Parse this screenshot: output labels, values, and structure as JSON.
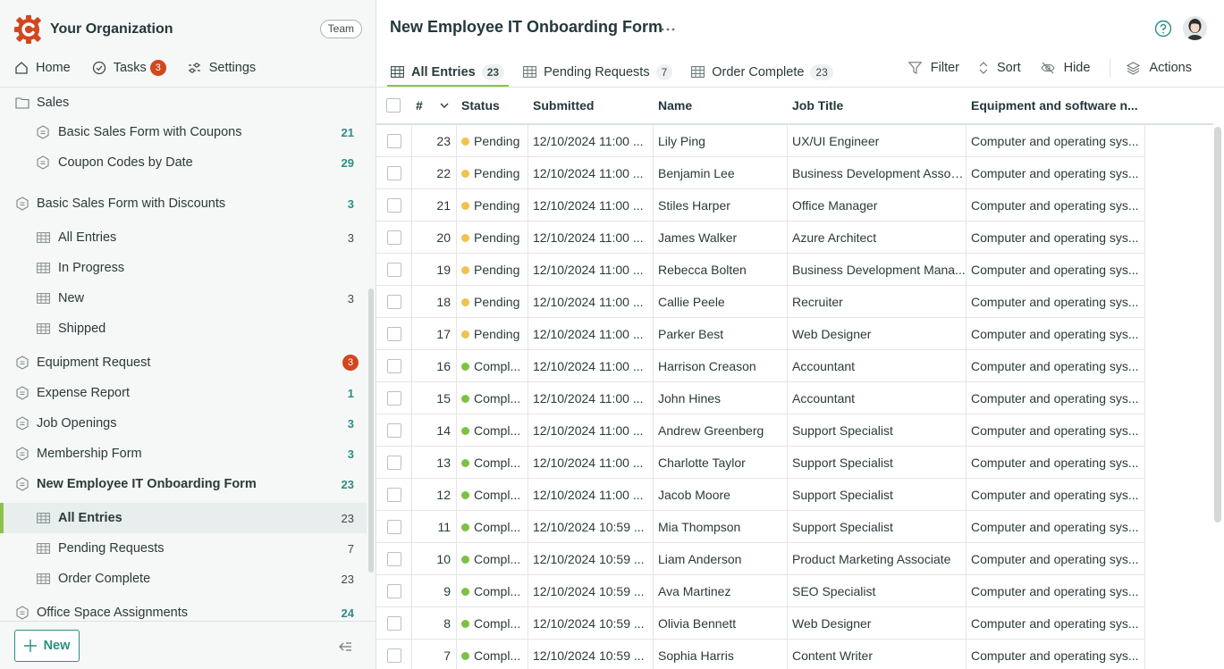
{
  "org": {
    "name": "Your Organization",
    "chip": "Team"
  },
  "topnav": {
    "home": "Home",
    "tasks": "Tasks",
    "tasks_count": "3",
    "settings": "Settings"
  },
  "tree": [
    {
      "kind": "folder",
      "label": "Sales",
      "count": "",
      "indent": 0,
      "style": ""
    },
    {
      "kind": "form",
      "label": "Basic Sales Form with Coupons",
      "count": "21",
      "indent": 1,
      "style": "teal"
    },
    {
      "kind": "form",
      "label": "Coupon Codes by Date",
      "count": "29",
      "indent": 1,
      "style": "teal"
    },
    {
      "kind": "form",
      "label": "Basic Sales Form with Discounts",
      "count": "3",
      "indent": 0,
      "style": "teal"
    },
    {
      "kind": "view",
      "label": "All Entries",
      "count": "3",
      "indent": 1,
      "style": ""
    },
    {
      "kind": "view",
      "label": "In Progress",
      "count": "",
      "indent": 1,
      "style": ""
    },
    {
      "kind": "view",
      "label": "New",
      "count": "3",
      "indent": 1,
      "style": ""
    },
    {
      "kind": "view",
      "label": "Shipped",
      "count": "",
      "indent": 1,
      "style": ""
    },
    {
      "kind": "form",
      "label": "Equipment Request",
      "count": "3",
      "indent": 0,
      "style": "badge"
    },
    {
      "kind": "form",
      "label": "Expense Report",
      "count": "1",
      "indent": 0,
      "style": "teal"
    },
    {
      "kind": "form",
      "label": "Job Openings",
      "count": "3",
      "indent": 0,
      "style": "teal"
    },
    {
      "kind": "form",
      "label": "Membership Form",
      "count": "3",
      "indent": 0,
      "style": "teal"
    },
    {
      "kind": "form",
      "label": "New Employee IT Onboarding Form",
      "count": "23",
      "indent": 0,
      "style": "teal",
      "bold": true
    },
    {
      "kind": "view",
      "label": "All Entries",
      "count": "23",
      "indent": 1,
      "style": "",
      "active": true
    },
    {
      "kind": "view",
      "label": "Pending Requests",
      "count": "7",
      "indent": 1,
      "style": ""
    },
    {
      "kind": "view",
      "label": "Order Complete",
      "count": "23",
      "indent": 1,
      "style": ""
    },
    {
      "kind": "form",
      "label": "Office Space Assignments",
      "count": "24",
      "indent": 0,
      "style": "teal"
    }
  ],
  "new_button": "New",
  "main": {
    "title": "New Employee IT Onboarding Form",
    "tabs": [
      {
        "label": "All Entries",
        "count": "23",
        "active": true
      },
      {
        "label": "Pending Requests",
        "count": "7",
        "active": false
      },
      {
        "label": "Order Complete",
        "count": "23",
        "active": false
      }
    ],
    "toolbar": {
      "filter": "Filter",
      "sort": "Sort",
      "hide": "Hide",
      "actions": "Actions"
    }
  },
  "colors": {
    "accent": "#2a8f83",
    "active_bar": "#8bc34a",
    "badge": "#d3471f",
    "pending": "#f2c14e",
    "complete": "#7cc242"
  },
  "table": {
    "headers": {
      "num": "#",
      "status": "Status",
      "submitted": "Submitted",
      "name": "Name",
      "job": "Job Title",
      "equip": "Equipment and software n..."
    },
    "rows": [
      {
        "n": "23",
        "status": "Pending",
        "state": "pending",
        "submitted": "12/10/2024 11:00 ...",
        "name": "Lily Ping",
        "job": "UX/UI Engineer",
        "equip": "Computer and operating sys..."
      },
      {
        "n": "22",
        "status": "Pending",
        "state": "pending",
        "submitted": "12/10/2024 11:00 ...",
        "name": "Benjamin Lee",
        "job": "Business Development Assoc...",
        "equip": "Computer and operating sys..."
      },
      {
        "n": "21",
        "status": "Pending",
        "state": "pending",
        "submitted": "12/10/2024 11:00 ...",
        "name": "Stiles Harper",
        "job": "Office Manager",
        "equip": "Computer and operating sys..."
      },
      {
        "n": "20",
        "status": "Pending",
        "state": "pending",
        "submitted": "12/10/2024 11:00 ...",
        "name": "James Walker",
        "job": "Azure Architect",
        "equip": "Computer and operating sys..."
      },
      {
        "n": "19",
        "status": "Pending",
        "state": "pending",
        "submitted": "12/10/2024 11:00 ...",
        "name": "Rebecca Bolten",
        "job": "Business Development Mana...",
        "equip": "Computer and operating sys..."
      },
      {
        "n": "18",
        "status": "Pending",
        "state": "pending",
        "submitted": "12/10/2024 11:00 ...",
        "name": "Callie Peele",
        "job": "Recruiter",
        "equip": "Computer and operating sys..."
      },
      {
        "n": "17",
        "status": "Pending",
        "state": "pending",
        "submitted": "12/10/2024 11:00 ...",
        "name": "Parker Best",
        "job": "Web Designer",
        "equip": "Computer and operating sys..."
      },
      {
        "n": "16",
        "status": "Compl...",
        "state": "complete",
        "submitted": "12/10/2024 11:00 ...",
        "name": "Harrison Creason",
        "job": "Accountant",
        "equip": "Computer and operating sys..."
      },
      {
        "n": "15",
        "status": "Compl...",
        "state": "complete",
        "submitted": "12/10/2024 11:00 ...",
        "name": "John Hines",
        "job": "Accountant",
        "equip": "Computer and operating sys..."
      },
      {
        "n": "14",
        "status": "Compl...",
        "state": "complete",
        "submitted": "12/10/2024 11:00 ...",
        "name": "Andrew Greenberg",
        "job": "Support Specialist",
        "equip": "Computer and operating sys..."
      },
      {
        "n": "13",
        "status": "Compl...",
        "state": "complete",
        "submitted": "12/10/2024 11:00 ...",
        "name": "Charlotte Taylor",
        "job": "Support Specialist",
        "equip": "Computer and operating sys..."
      },
      {
        "n": "12",
        "status": "Compl...",
        "state": "complete",
        "submitted": "12/10/2024 11:00 ...",
        "name": "Jacob Moore",
        "job": "Support Specialist",
        "equip": "Computer and operating sys..."
      },
      {
        "n": "11",
        "status": "Compl...",
        "state": "complete",
        "submitted": "12/10/2024 10:59 ...",
        "name": "Mia Thompson",
        "job": "Support Specialist",
        "equip": "Computer and operating sys..."
      },
      {
        "n": "10",
        "status": "Compl...",
        "state": "complete",
        "submitted": "12/10/2024 10:59 ...",
        "name": "Liam Anderson",
        "job": "Product Marketing Associate",
        "equip": "Computer and operating sys..."
      },
      {
        "n": "9",
        "status": "Compl...",
        "state": "complete",
        "submitted": "12/10/2024 10:59 ...",
        "name": "Ava Martinez",
        "job": "SEO Specialist",
        "equip": "Computer and operating sys..."
      },
      {
        "n": "8",
        "status": "Compl...",
        "state": "complete",
        "submitted": "12/10/2024 10:59 ...",
        "name": "Olivia Bennett",
        "job": "Web Designer",
        "equip": "Computer and operating sys..."
      },
      {
        "n": "7",
        "status": "Compl...",
        "state": "complete",
        "submitted": "12/10/2024 10:59 ...",
        "name": "Sophia Harris",
        "job": "Content Writer",
        "equip": "Computer and operating sys..."
      }
    ]
  }
}
